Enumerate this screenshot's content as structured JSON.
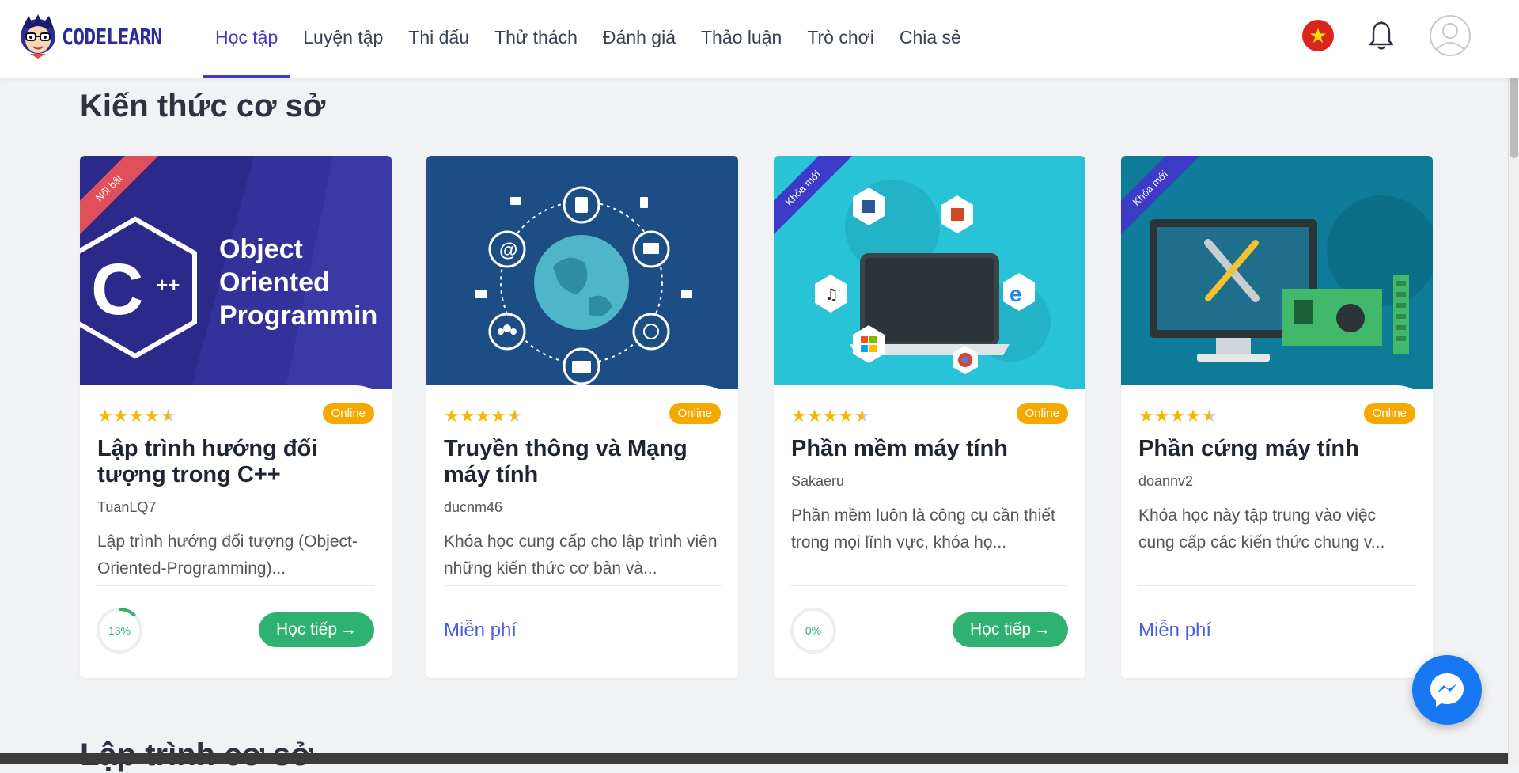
{
  "brand": {
    "name": "CODELEARN"
  },
  "nav": {
    "items": [
      "Học tập",
      "Luyện tập",
      "Thi đấu",
      "Thử thách",
      "Đánh giá",
      "Thảo luận",
      "Trò chơi",
      "Chia sẻ"
    ],
    "active": "Học tập"
  },
  "header_icons": [
    "vietnam-flag-icon",
    "bell-icon",
    "user-avatar-icon"
  ],
  "section": {
    "title": "Kiến thức cơ sở",
    "next_title": "Lập trình cơ sở"
  },
  "cards": [
    {
      "ribbon": "Nổi bật",
      "ribbon_color": "#e0505a",
      "cover_text": "Object Oriented Programmin",
      "rating": 4.5,
      "badge": "Online",
      "title": "Lập trình hướng đối tượng trong C++",
      "author": "TuanLQ7",
      "desc": "Lập trình hướng đối tượng (Object-Oriented-Programming)...",
      "progress_label": "13%",
      "progress": 0.13,
      "button": "Học tiếp",
      "price": ""
    },
    {
      "ribbon": "",
      "ribbon_color": "",
      "cover_text": "",
      "rating": 4.5,
      "badge": "Online",
      "title": "Truyền thông và Mạng máy tính",
      "author": "ducnm46",
      "desc": "Khóa học cung cấp cho lập trình viên những kiến thức cơ bản và...",
      "progress_label": "",
      "progress": null,
      "button": "",
      "price": "Miễn phí"
    },
    {
      "ribbon": "Khóa mới",
      "ribbon_color": "#3b3bc8",
      "cover_text": "",
      "rating": 4.5,
      "badge": "Online",
      "title": "Phần mềm máy tính",
      "author": "Sakaeru",
      "desc": "Phần mềm luôn là công cụ cần thiết trong mọi lĩnh vực, khóa họ...",
      "progress_label": "0%",
      "progress": 0,
      "button": "Học tiếp",
      "price": ""
    },
    {
      "ribbon": "Khóa mới",
      "ribbon_color": "#3b3bc8",
      "cover_text": "",
      "rating": 4.5,
      "badge": "Online",
      "title": "Phần cứng máy tính",
      "author": "doannv2",
      "desc": "Khóa học này tập trung vào việc cung cấp các kiến thức chung v...",
      "progress_label": "",
      "progress": null,
      "button": "",
      "price": "Miễn phí"
    }
  ],
  "colors": {
    "accent": "#4338ca",
    "online_badge": "#f5a800",
    "continue_button": "#2fb171",
    "free_link": "#4c5fe0",
    "messenger": "#1877f2"
  }
}
